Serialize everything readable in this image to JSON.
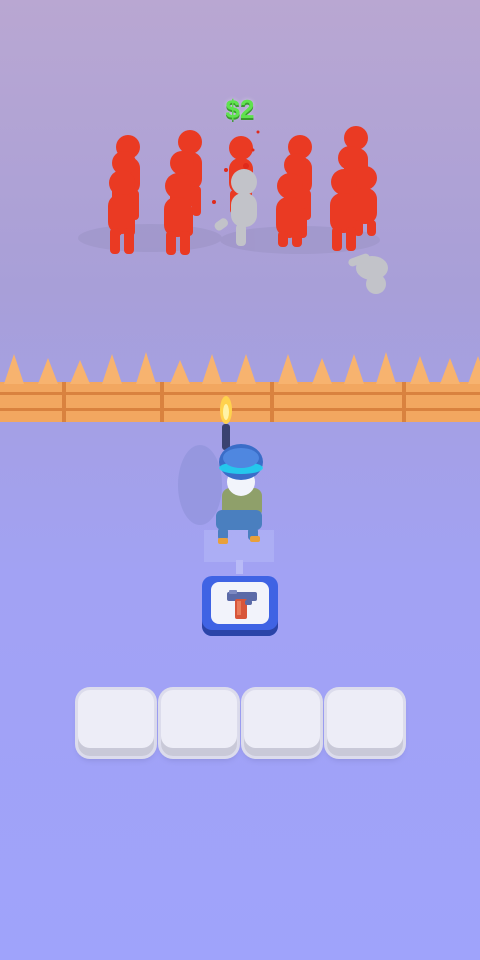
{
  "hud": {
    "money": "$2"
  },
  "colors": {
    "enemy": "#ea3a23",
    "dead_enemy": "#c2c3c9",
    "fence": "#f2a760",
    "ground": "#a2a3f6",
    "money": "#5fe34e",
    "weapon_card": "#3f63e4"
  },
  "weapon_card": {
    "icon": "pistol-icon"
  },
  "inventory_slots": [
    {
      "state": "empty"
    },
    {
      "state": "empty"
    },
    {
      "state": "empty"
    },
    {
      "state": "empty"
    }
  ]
}
